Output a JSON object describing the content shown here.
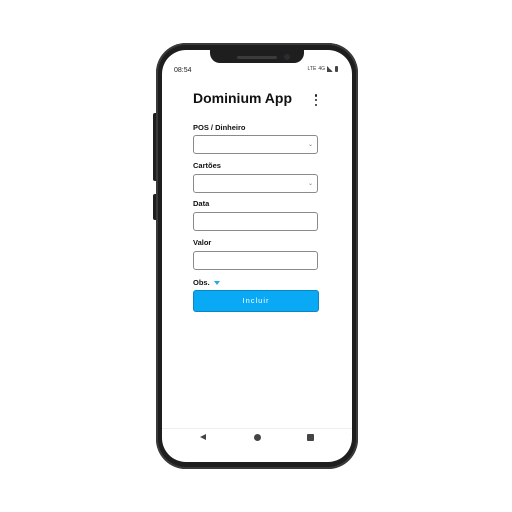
{
  "status": {
    "time": "08:54",
    "network": "4G",
    "carrier": "LTE"
  },
  "app": {
    "title": "Dominium App"
  },
  "form": {
    "pos_label": "POS / Dinheiro",
    "cards_label": "Cartões",
    "date_label": "Data",
    "value_label": "Valor",
    "obs_label": "Obs.",
    "submit_label": "Incluir"
  },
  "colors": {
    "accent": "#0aa9f5",
    "obs_arrow": "#29a8e8",
    "frame": "#1e1e1e"
  }
}
